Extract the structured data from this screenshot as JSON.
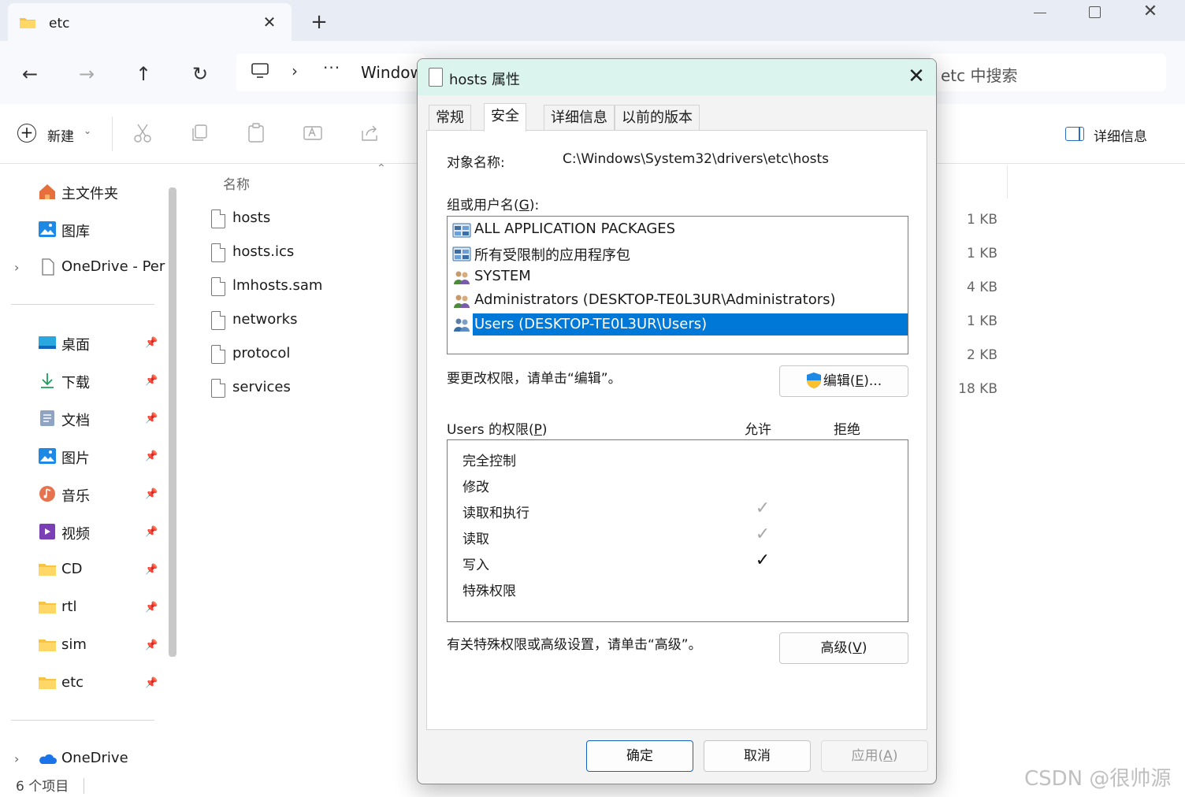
{
  "explorer": {
    "tab_title": "etc",
    "address_fragment": "Windows",
    "address_dots": "···",
    "search_placeholder": "etc 中搜索",
    "new_label": "新建",
    "details_label": "详细信息",
    "column_name": "名称",
    "status_text": "6 个项目",
    "sidebar": {
      "top": [
        {
          "label": "主文件夹",
          "icon": "home-icon"
        },
        {
          "label": "图库",
          "icon": "gallery-icon"
        },
        {
          "label": "OneDrive - Per",
          "icon": "file-icon"
        }
      ],
      "pinned": [
        {
          "label": "桌面",
          "icon": "desktop-icon"
        },
        {
          "label": "下载",
          "icon": "download-icon"
        },
        {
          "label": "文档",
          "icon": "document-icon"
        },
        {
          "label": "图片",
          "icon": "pictures-icon"
        },
        {
          "label": "音乐",
          "icon": "music-icon"
        },
        {
          "label": "视频",
          "icon": "video-icon"
        },
        {
          "label": "CD",
          "icon": "folder-icon"
        },
        {
          "label": "rtl",
          "icon": "folder-icon"
        },
        {
          "label": "sim",
          "icon": "folder-icon"
        },
        {
          "label": "etc",
          "icon": "folder-icon"
        }
      ],
      "bottom": [
        {
          "label": "OneDrive",
          "icon": "cloud-icon"
        }
      ]
    },
    "files": [
      {
        "name": "hosts",
        "size": "1 KB"
      },
      {
        "name": "hosts.ics",
        "size": "1 KB"
      },
      {
        "name": "lmhosts.sam",
        "size": "4 KB"
      },
      {
        "name": "networks",
        "size": "1 KB"
      },
      {
        "name": "protocol",
        "size": "2 KB"
      },
      {
        "name": "services",
        "size": "18 KB"
      }
    ],
    "watermark": "CSDN @很帅源"
  },
  "dialog": {
    "title": "hosts 属性",
    "tabs": [
      "常规",
      "安全",
      "详细信息",
      "以前的版本"
    ],
    "active_tab": "安全",
    "object_name_label": "对象名称:",
    "object_name_value": "C:\\Windows\\System32\\drivers\\etc\\hosts",
    "group_label_text": "组或用户名(",
    "group_label_key": "G",
    "group_label_end": "):",
    "users": [
      {
        "label": "ALL APPLICATION PACKAGES",
        "icon": "app-packages-icon"
      },
      {
        "label": "所有受限制的应用程序包",
        "icon": "app-packages-icon"
      },
      {
        "label": "SYSTEM",
        "icon": "users-group-icon"
      },
      {
        "label": "Administrators (DESKTOP-TE0L3UR\\Administrators)",
        "icon": "users-group-icon"
      },
      {
        "label": "Users (DESKTOP-TE0L3UR\\Users)",
        "icon": "users-group-icon",
        "selected": true
      }
    ],
    "change_hint": "要更改权限，请单击“编辑”。",
    "edit_button_text": "编辑(",
    "edit_button_key": "E",
    "edit_button_end": ")...",
    "perm_label_text": "Users 的权限(",
    "perm_label_key": "P",
    "perm_label_end": ")",
    "allow_header": "允许",
    "deny_header": "拒绝",
    "permissions": [
      {
        "name": "完全控制",
        "allow": "none"
      },
      {
        "name": "修改",
        "allow": "none"
      },
      {
        "name": "读取和执行",
        "allow": "inherited"
      },
      {
        "name": "读取",
        "allow": "inherited"
      },
      {
        "name": "写入",
        "allow": "explicit"
      },
      {
        "name": "特殊权限",
        "allow": "none"
      }
    ],
    "advanced_hint": "有关特殊权限或高级设置，请单击“高级”。",
    "advanced_button_text": "高级(",
    "advanced_button_key": "V",
    "advanced_button_end": ")",
    "ok_label": "确定",
    "cancel_label": "取消",
    "apply_text": "应用(",
    "apply_key": "A",
    "apply_end": ")",
    "checkmark": "✓",
    "colors": {
      "selection": "#0078d7",
      "titlebar": "#dcf4ee",
      "primary_border": "#1565c0"
    }
  }
}
